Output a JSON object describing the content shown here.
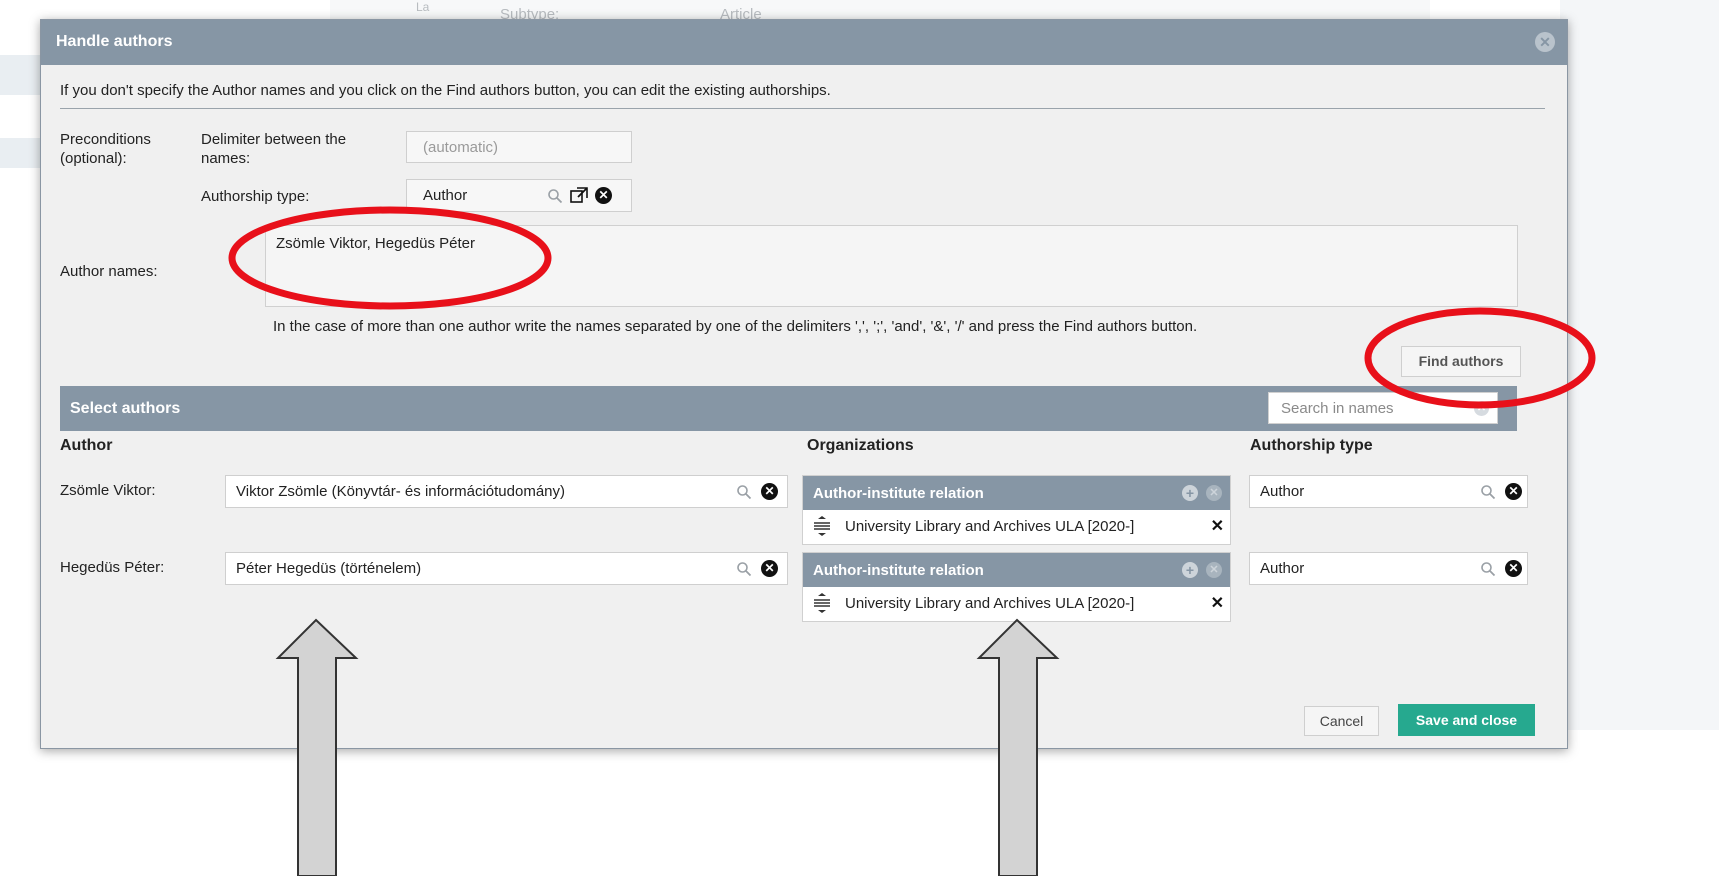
{
  "background": {
    "lang_fragment": "La",
    "subtype_label": "Subtype:",
    "subtype_value": "Article"
  },
  "dialog": {
    "title": "Handle authors",
    "close_icon": "close-circle-icon",
    "info_text": "If you don't specify the Author names and you click on the Find authors button, you can edit the existing authorships."
  },
  "preconditions": {
    "label": "Preconditions (optional):",
    "delimiter_label": "Delimiter between the names:",
    "delimiter_placeholder": "(automatic)",
    "authorship_type_label": "Authorship type:",
    "authorship_type_value": "Author"
  },
  "author_names": {
    "label": "Author names:",
    "value": "Zsömle Viktor, Hegedüs Péter",
    "hint": "In the case of more than one author write the names separated by one of the delimiters ',', ';', 'and', '&', '/' and press the Find authors button.",
    "find_button": "Find authors"
  },
  "select_authors": {
    "title": "Select authors",
    "search_placeholder": "Search in names",
    "columns": {
      "author": "Author",
      "organizations": "Organizations",
      "authorship_type": "Authorship type"
    },
    "rows": [
      {
        "name_label": "Zsömle Viktor:",
        "match": "Viktor Zsömle (Könyvtár- és információtudomány)",
        "relation_title": "Author-institute relation",
        "organization": "University Library and Archives ULA [2020-]",
        "authorship_type": "Author"
      },
      {
        "name_label": "Hegedüs Péter:",
        "match": "Péter Hegedüs (történelem)",
        "relation_title": "Author-institute relation",
        "organization": "University Library and Archives ULA [2020-]",
        "authorship_type": "Author"
      }
    ]
  },
  "footer": {
    "cancel": "Cancel",
    "save": "Save and close"
  },
  "colors": {
    "header": "#8696a5",
    "dialog_bg": "#f0f0f0",
    "save_button": "#26a98f",
    "annotation_red": "#e8101a",
    "arrow_fill": "#d3d3d3"
  }
}
